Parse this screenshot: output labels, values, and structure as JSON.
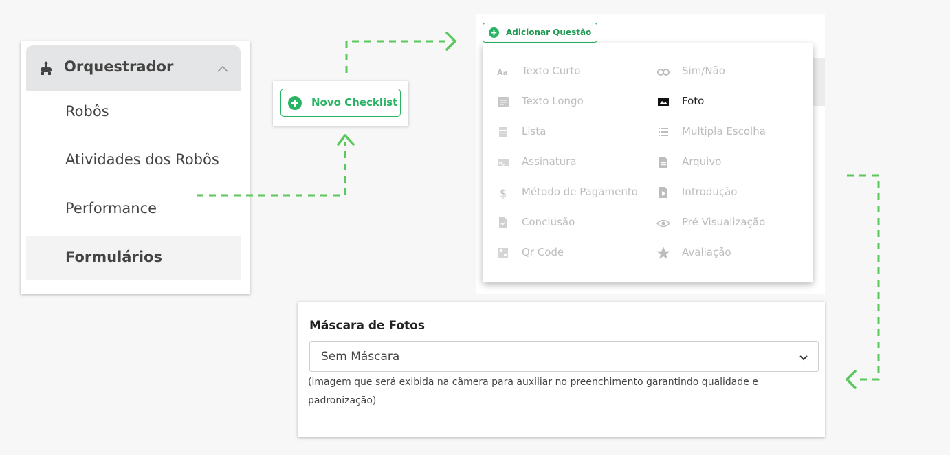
{
  "sidebar": {
    "header": {
      "title": "Orquestrador",
      "icon": "robot-icon",
      "chevron": "chevron-up-icon"
    },
    "items": [
      {
        "label": "Robôs"
      },
      {
        "label": "Atividades dos Robôs"
      },
      {
        "label": "Performance"
      },
      {
        "label": "Formulários",
        "active": true
      }
    ]
  },
  "novo_checklist": {
    "label": "Novo Checklist",
    "icon": "plus-circle-icon"
  },
  "adicionar_questao": {
    "label": "Adicionar Questão",
    "icon": "plus-circle-icon",
    "menu": {
      "left": [
        {
          "label": "Texto Curto",
          "icon": "text-aa-icon"
        },
        {
          "label": "Texto Longo",
          "icon": "long-text-icon"
        },
        {
          "label": "Lista",
          "icon": "list-icon"
        },
        {
          "label": "Assinatura",
          "icon": "signature-icon"
        },
        {
          "label": "Método de Pagamento",
          "icon": "dollar-icon"
        },
        {
          "label": "Conclusão",
          "icon": "document-check-icon"
        },
        {
          "label": "Qr Code",
          "icon": "qr-code-icon"
        }
      ],
      "right": [
        {
          "label": "Sim/Não",
          "icon": "toggle-icon"
        },
        {
          "label": "Foto",
          "icon": "photo-icon",
          "highlighted": true
        },
        {
          "label": "Multipla Escolha",
          "icon": "checklist-icon"
        },
        {
          "label": "Arquivo",
          "icon": "file-icon"
        },
        {
          "label": "Introdução",
          "icon": "play-document-icon"
        },
        {
          "label": "Pré Visualização",
          "icon": "eye-icon"
        },
        {
          "label": "Avaliação",
          "icon": "star-icon"
        }
      ]
    }
  },
  "mascara": {
    "title": "Máscara de Fotos",
    "selected": "Sem Máscara",
    "help": "(imagem que será exibida na câmera para auxiliar no preenchimento garantindo qualidade e padronização)"
  },
  "colors": {
    "accent": "#28b463",
    "arrow": "#5bc85b",
    "disabled": "#bdbdbd"
  }
}
